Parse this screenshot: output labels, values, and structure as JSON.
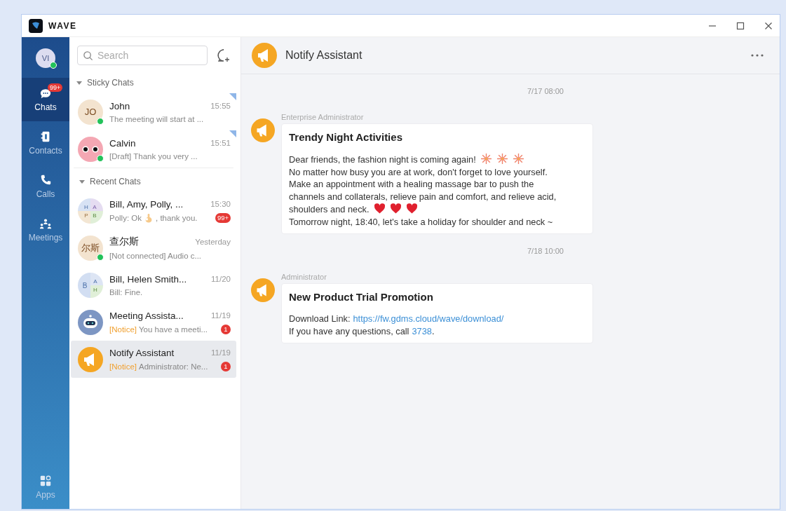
{
  "window": {
    "app_name": "WAVE"
  },
  "nav": {
    "user": {
      "initials": "VI",
      "online": true
    },
    "items": [
      {
        "label": "Chats",
        "selected": true,
        "badge": "99+"
      },
      {
        "label": "Contacts",
        "selected": false
      },
      {
        "label": "Calls",
        "selected": false
      },
      {
        "label": "Meetings",
        "selected": false
      }
    ],
    "bottom_items": [
      {
        "label": "Apps",
        "selected": false
      }
    ]
  },
  "chat_list": {
    "search": {
      "placeholder": "Search"
    },
    "sections": [
      {
        "title": "Sticky Chats",
        "expanded": true,
        "chats": [
          {
            "name": "John",
            "time": "15:55",
            "avatar": {
              "kind": "initials",
              "text": "JO"
            },
            "online": true,
            "pinned": true,
            "selected": false,
            "preview": [
              {
                "kind": "text",
                "text": "The meeting will start at ..."
              }
            ]
          },
          {
            "name": "Calvin",
            "time": "15:51",
            "avatar": {
              "kind": "face"
            },
            "online": true,
            "pinned": true,
            "selected": false,
            "preview": [
              {
                "kind": "text",
                "text": "[Draft] Thank you very ..."
              }
            ]
          }
        ]
      },
      {
        "title": "Recent Chats",
        "expanded": true,
        "chats": [
          {
            "name": "Bill, Amy, Polly,  ...",
            "time": "15:30",
            "avatar": {
              "kind": "group4",
              "letters": [
                "H",
                "A",
                "P",
                "B"
              ]
            },
            "online": false,
            "pinned": false,
            "selected": false,
            "badge": "99+",
            "preview": [
              {
                "kind": "text",
                "text": "Polly: Ok"
              },
              {
                "kind": "okhand"
              },
              {
                "kind": "text",
                "text": ", thank you."
              }
            ]
          },
          {
            "name": "查尔斯",
            "time": "Yesterday",
            "avatar": {
              "kind": "initials",
              "text": "尔斯"
            },
            "online": true,
            "pinned": false,
            "selected": false,
            "preview": [
              {
                "kind": "text",
                "text": "[Not connected] Audio c..."
              }
            ]
          },
          {
            "name": "Bill, Helen Smith...",
            "time": "11/20",
            "avatar": {
              "kind": "group3",
              "letters": [
                "B",
                "A",
                "H"
              ]
            },
            "online": false,
            "pinned": false,
            "selected": false,
            "preview": [
              {
                "kind": "text",
                "text": "Bill: Fine."
              }
            ]
          },
          {
            "name": "Meeting Assista...",
            "time": "11/19",
            "avatar": {
              "kind": "robot"
            },
            "online": false,
            "pinned": false,
            "selected": false,
            "badge": "1",
            "preview": [
              {
                "kind": "tag",
                "text": "[Notice]"
              },
              {
                "kind": "text",
                "text": "You have a meeti..."
              }
            ]
          },
          {
            "name": "Notify Assistant",
            "time": "11/19",
            "avatar": {
              "kind": "megaphone"
            },
            "online": false,
            "pinned": false,
            "selected": true,
            "badge": "1",
            "preview": [
              {
                "kind": "tag",
                "text": "[Notice]"
              },
              {
                "kind": "text",
                "text": "Administrator: Ne..."
              }
            ]
          }
        ]
      }
    ]
  },
  "conversation": {
    "title": "Notify Assistant",
    "messages": [
      {
        "kind": "time",
        "text": "7/17 08:00"
      },
      {
        "kind": "card",
        "sender": "Enterprise Administrator",
        "title": "Trendy Night Activities",
        "lines": [
          [
            {
              "kind": "text",
              "text": "Dear friends, the fashion night is coming again!"
            },
            {
              "kind": "fireworks"
            },
            {
              "kind": "fireworks"
            },
            {
              "kind": "fireworks"
            }
          ],
          [
            {
              "kind": "text",
              "text": "No matter how busy you are at work, don't forget to love yourself."
            }
          ],
          [
            {
              "kind": "text",
              "text": "Make an appointment with a healing massage bar to push the"
            }
          ],
          [
            {
              "kind": "text",
              "text": "channels and collaterals, relieve pain and comfort, and relieve acid,"
            }
          ],
          [
            {
              "kind": "text",
              "text": "shoulders and neck."
            },
            {
              "kind": "heart"
            },
            {
              "kind": "heart"
            },
            {
              "kind": "heart"
            }
          ],
          [
            {
              "kind": "text",
              "text": "Tomorrow night, 18:40, let's take a holiday for shoulder and neck ~"
            }
          ]
        ]
      },
      {
        "kind": "time",
        "text": "7/18 10:00"
      },
      {
        "kind": "card",
        "sender": "Administrator",
        "title": "New Product Trial Promotion",
        "lines": [
          [
            {
              "kind": "text",
              "text": "Download Link:"
            },
            {
              "kind": "link",
              "text": "https://fw.gdms.cloud/wave/download/"
            }
          ],
          [
            {
              "kind": "text",
              "text": "If you have any questions, call"
            },
            {
              "kind": "link",
              "text": "3738"
            },
            {
              "kind": "text",
              "text": "."
            }
          ]
        ]
      }
    ]
  }
}
